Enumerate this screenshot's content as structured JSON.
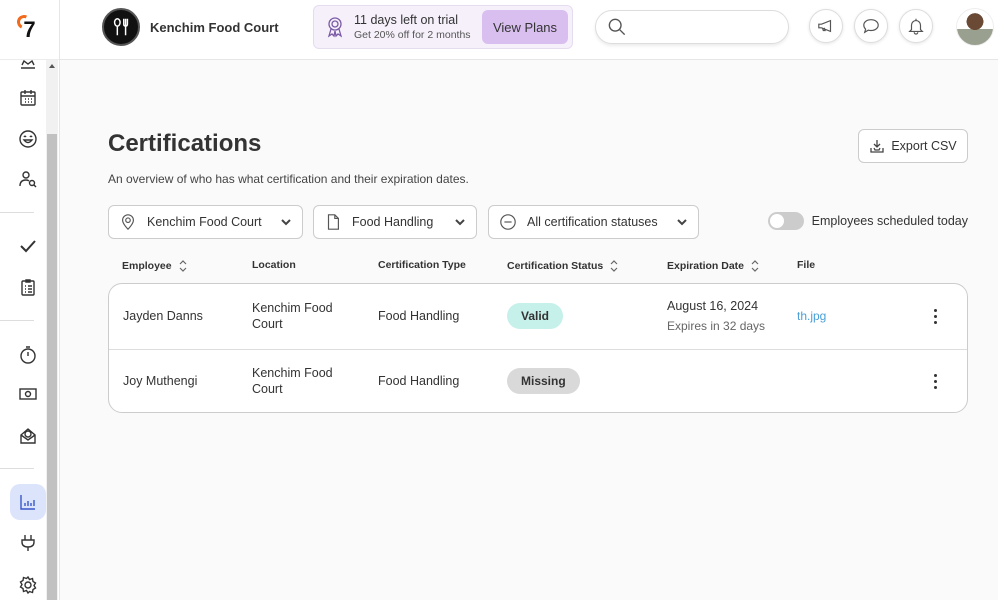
{
  "app": {
    "logo_text": "7"
  },
  "header": {
    "location_name": "Kenchim Food Court",
    "trial": {
      "title": "11 days left on trial",
      "subtitle": "Get 20% off for 2 months",
      "button_label": "View Plans"
    },
    "search": {
      "placeholder": "",
      "value": ""
    },
    "buttons": [
      "announcements-icon",
      "messages-icon",
      "notifications-icon"
    ]
  },
  "sidebar": {
    "items": [
      {
        "name": "crown",
        "active": false
      },
      {
        "name": "schedule",
        "active": false
      },
      {
        "name": "engagement",
        "active": false
      },
      {
        "name": "hiring",
        "active": false
      },
      {
        "name": "tasks",
        "active": false
      },
      {
        "name": "logbook",
        "active": false
      },
      {
        "name": "time-clock",
        "active": false
      },
      {
        "name": "payroll",
        "active": false
      },
      {
        "name": "tips",
        "active": false
      },
      {
        "name": "reports",
        "active": true
      },
      {
        "name": "integrations",
        "active": false
      },
      {
        "name": "settings",
        "active": false
      }
    ]
  },
  "page": {
    "title": "Certifications",
    "subtitle": "An overview of who has what certification and their expiration dates.",
    "export_label": "Export CSV",
    "filters": {
      "location": "Kenchim Food Court",
      "certification_type": "Food Handling",
      "status": "All certification statuses"
    },
    "toggle": {
      "label": "Employees scheduled today",
      "on": false
    }
  },
  "table": {
    "columns": [
      "Employee",
      "Location",
      "Certification Type",
      "Certification Status",
      "Expiration Date",
      "File"
    ],
    "rows": [
      {
        "employee": "Jayden Danns",
        "location_line1": "Kenchim Food",
        "location_line2": "Court",
        "type": "Food Handling",
        "status": "Valid",
        "expiration": "August 16, 2024",
        "expires_in": "Expires in 32 days",
        "file": "th.jpg"
      },
      {
        "employee": "Joy Muthengi",
        "location_line1": "Kenchim Food",
        "location_line2": "Court",
        "type": "Food Handling",
        "status": "Missing",
        "expiration": "",
        "expires_in": "",
        "file": ""
      }
    ]
  }
}
